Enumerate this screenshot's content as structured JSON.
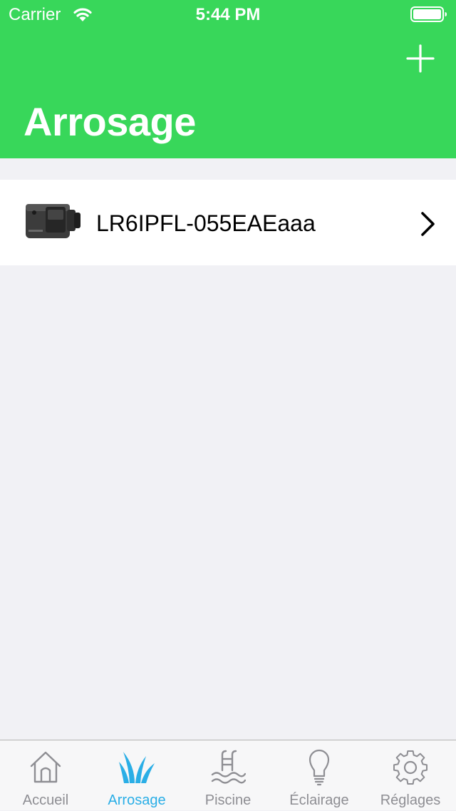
{
  "status_bar": {
    "carrier": "Carrier",
    "time": "5:44 PM"
  },
  "header": {
    "title": "Arrosage",
    "add_icon": "plus-icon",
    "background_color": "#38d75a"
  },
  "devices": [
    {
      "name": "LR6IPFL-055EAEaaa",
      "thumbnail": "controller-device-image",
      "accessory_icon": "chevron-right-icon"
    }
  ],
  "tab_bar": {
    "active_color": "#2aaee6",
    "inactive_color": "#8e8e93",
    "tabs": [
      {
        "label": "Accueil",
        "icon": "home-icon",
        "active": false
      },
      {
        "label": "Arrosage",
        "icon": "grass-icon",
        "active": true
      },
      {
        "label": "Piscine",
        "icon": "pool-ladder-icon",
        "active": false
      },
      {
        "label": "Éclairage",
        "icon": "lightbulb-icon",
        "active": false
      },
      {
        "label": "Réglages",
        "icon": "gear-icon",
        "active": false
      }
    ]
  }
}
